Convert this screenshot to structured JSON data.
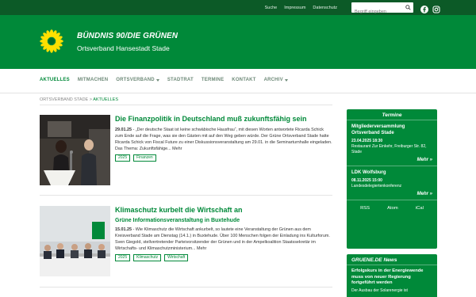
{
  "topbar": {
    "links": [
      "Suche",
      "Impressum",
      "Datenschutz"
    ],
    "search_placeholder": "Begriff eingeben",
    "social": [
      "facebook-icon",
      "instagram-icon"
    ]
  },
  "header": {
    "name": "BÜNDNIS 90/DIE GRÜNEN",
    "subtitle": "Ortsverband Hansestadt Stade"
  },
  "nav": {
    "items": [
      "AKTUELLES",
      "MITMACHEN",
      "ORTSVERBAND",
      "STADTRAT",
      "TERMINE",
      "KONTAKT",
      "ARCHIV"
    ]
  },
  "breadcrumb": {
    "root": "ORTSVERBAND STADE",
    "sep": ">",
    "current": "AKTUELLES"
  },
  "articles": [
    {
      "title": "Die Finanzpolitik in Deutschland muß zukunftsfähig sein",
      "date": "29.01.25",
      "text": " - „Der deutsche Staat ist keine schwäbische Hausfrau“, mit diesen Worten antwortete Ricarda Schick zum Ende auf die Frage, was sie den Gästen mit auf den Weg geben würde. Der Grüne Ortsverband Stade hatte Ricarda Schick von Fiscal Future zu einer Diskussionsveranstaltung am 29.01. in die Seminarturnhalle eingeladen. Das Thema: Zukunftsfähige... Mehr",
      "tags": [
        "2025",
        "Finanzen"
      ]
    },
    {
      "title": "Klimaschutz kurbelt die Wirtschaft an",
      "subtitle": "Grüne Informationsveranstaltung in Buxtehude",
      "date": "15.01.25",
      "text": " - Wie Klimaschutz die Wirtschaft ankurbelt, so lautete eine Veranstaltung der Grünen aus dem Kreisverband Stade am Dienstag (14.1.) in Buxtehude. Über 100 Menschen folgen der Einladung ins Kulturforum. Sven Giegold, stellvertretender Parteivorsitzender der Grünen und in der Ampelkoalition Staatssekretär im Wirtschafts- und Klimaschutzministerium... Mehr",
      "tags": [
        "2025",
        "Klimaschutz",
        "Wirtschaft"
      ]
    }
  ],
  "termine": {
    "title": "Termine",
    "events": [
      {
        "title": "Mitgliederversammlung Ortsverband Stade",
        "date": "23.04.2025 18:30",
        "location": "Restaurant Zur Einkehr, Freiburger Str. 82, Stade",
        "more": "Mehr »"
      },
      {
        "title": "LDK Wolfsburg",
        "date": "08.11.2025 15:00",
        "location": "Landesdelegiertenkonferenz",
        "more": "Mehr »"
      }
    ],
    "feeds": [
      "RSS",
      "Atom",
      "iCal"
    ]
  },
  "gruene_news": {
    "title": "GRUENE.DE News",
    "headline": "Erfolgskurs in der Energiewende muss von neuer Regierung fortgeführt werden",
    "teaser": "Der Ausbau der Solarenergie ist"
  },
  "colors": {
    "dark_green": "#0c5a27",
    "green": "#008939",
    "sunflower": "#ffe000"
  }
}
